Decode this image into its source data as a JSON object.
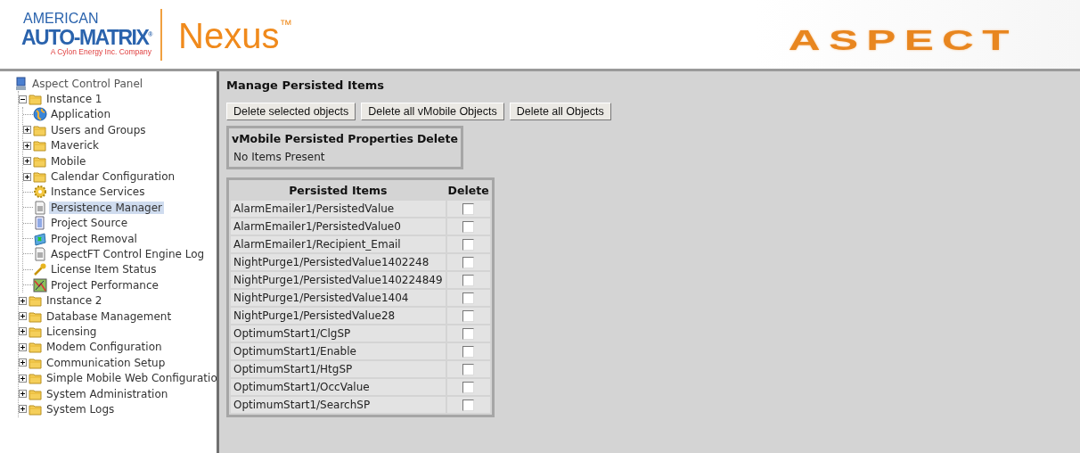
{
  "header": {
    "brand_top": "AMERICAN",
    "brand_main": "AUTO-MATRIX",
    "brand_mark": "®",
    "brand_tagline": "A Cylon Energy Inc. Company",
    "product": "Nexus",
    "product_mark": "™",
    "aspect_logo": "ASPECT"
  },
  "tree": {
    "label": "Aspect Control Panel",
    "kind": "computer",
    "children": [
      {
        "label": "Instance 1",
        "kind": "folder",
        "expanded": true,
        "children": [
          {
            "label": "Application",
            "kind": "globe",
            "selected": false
          },
          {
            "label": "Users and Groups",
            "kind": "folder",
            "expanded": false,
            "selected": false
          },
          {
            "label": "Maverick",
            "kind": "folder",
            "expanded": false,
            "selected": false
          },
          {
            "label": "Mobile",
            "kind": "folder",
            "expanded": false,
            "selected": false
          },
          {
            "label": "Calendar Configuration",
            "kind": "folder",
            "expanded": false,
            "selected": false
          },
          {
            "label": "Instance Services",
            "kind": "gear",
            "selected": false
          },
          {
            "label": "Persistence Manager",
            "kind": "document",
            "selected": true
          },
          {
            "label": "Project Source",
            "kind": "list",
            "selected": false
          },
          {
            "label": "Project Removal",
            "kind": "removal",
            "selected": false
          },
          {
            "label": "AspectFT Control Engine Log",
            "kind": "document",
            "selected": false
          },
          {
            "label": "License Item Status",
            "kind": "key",
            "selected": false
          },
          {
            "label": "Project Performance",
            "kind": "chart",
            "selected": false
          }
        ]
      },
      {
        "label": "Instance 2",
        "kind": "folder",
        "expanded": false
      },
      {
        "label": "Database Management",
        "kind": "folder",
        "expanded": false
      },
      {
        "label": "Licensing",
        "kind": "folder",
        "expanded": false
      },
      {
        "label": "Modem Configuration",
        "kind": "folder",
        "expanded": false
      },
      {
        "label": "Communication Setup",
        "kind": "folder",
        "expanded": false
      },
      {
        "label": "Simple Mobile Web Configuratio",
        "kind": "folder",
        "expanded": false
      },
      {
        "label": "System Administration",
        "kind": "folder",
        "expanded": false
      },
      {
        "label": "System Logs",
        "kind": "folder",
        "expanded": false
      }
    ]
  },
  "page": {
    "title": "Manage Persisted Items",
    "buttons": [
      "Delete selected objects",
      "Delete all vMobile Objects",
      "Delete all Objects"
    ],
    "vmobile_table": {
      "columns": [
        "vMobile Persisted Properties",
        "Delete"
      ],
      "empty_message": "No Items Present"
    },
    "items_table": {
      "columns": [
        "Persisted Items",
        "Delete"
      ],
      "rows": [
        {
          "name": "AlarmEmailer1/PersistedValue",
          "checked": false
        },
        {
          "name": "AlarmEmailer1/PersistedValue0",
          "checked": false
        },
        {
          "name": "AlarmEmailer1/Recipient_Email",
          "checked": false
        },
        {
          "name": "NightPurge1/PersistedValue1402248",
          "checked": false
        },
        {
          "name": "NightPurge1/PersistedValue140224849",
          "checked": false
        },
        {
          "name": "NightPurge1/PersistedValue1404",
          "checked": false
        },
        {
          "name": "NightPurge1/PersistedValue28",
          "checked": false
        },
        {
          "name": "OptimumStart1/ClgSP",
          "checked": false
        },
        {
          "name": "OptimumStart1/Enable",
          "checked": false
        },
        {
          "name": "OptimumStart1/HtgSP",
          "checked": false
        },
        {
          "name": "OptimumStart1/OccValue",
          "checked": false
        },
        {
          "name": "OptimumStart1/SearchSP",
          "checked": false
        }
      ]
    }
  }
}
